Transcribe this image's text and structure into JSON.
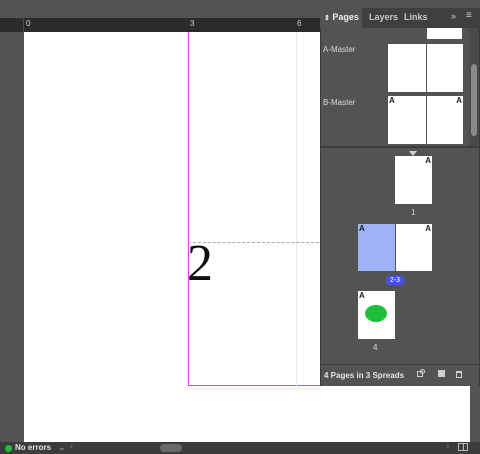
{
  "ruler": {
    "labels": [
      "0",
      "3",
      "6"
    ]
  },
  "canvas": {
    "page_number": "2"
  },
  "panel": {
    "tabs": [
      {
        "label": "Pages",
        "icon": "collapse-arrows-icon",
        "active": true
      },
      {
        "label": "Layers",
        "active": false
      },
      {
        "label": "Links",
        "active": false
      }
    ],
    "masters": [
      {
        "label": "A-Master"
      },
      {
        "label": "B-Master",
        "letter_left": "A",
        "letter_right": "A"
      }
    ],
    "pages": [
      {
        "number": "1",
        "letter": "A"
      },
      {
        "number": "2-3",
        "letter_left": "A",
        "letter_right": "A"
      },
      {
        "number": "4",
        "letter": "A"
      }
    ],
    "footer": {
      "text": "4 Pages in 3 Spreads"
    }
  },
  "status": {
    "text": "No errors",
    "color": "#1fbf3a"
  },
  "colors": {
    "selection": "#9eb3f7",
    "badge": "#4455dd",
    "margin_guide": "#d04ad6",
    "ellipse": "#1dbf38"
  }
}
